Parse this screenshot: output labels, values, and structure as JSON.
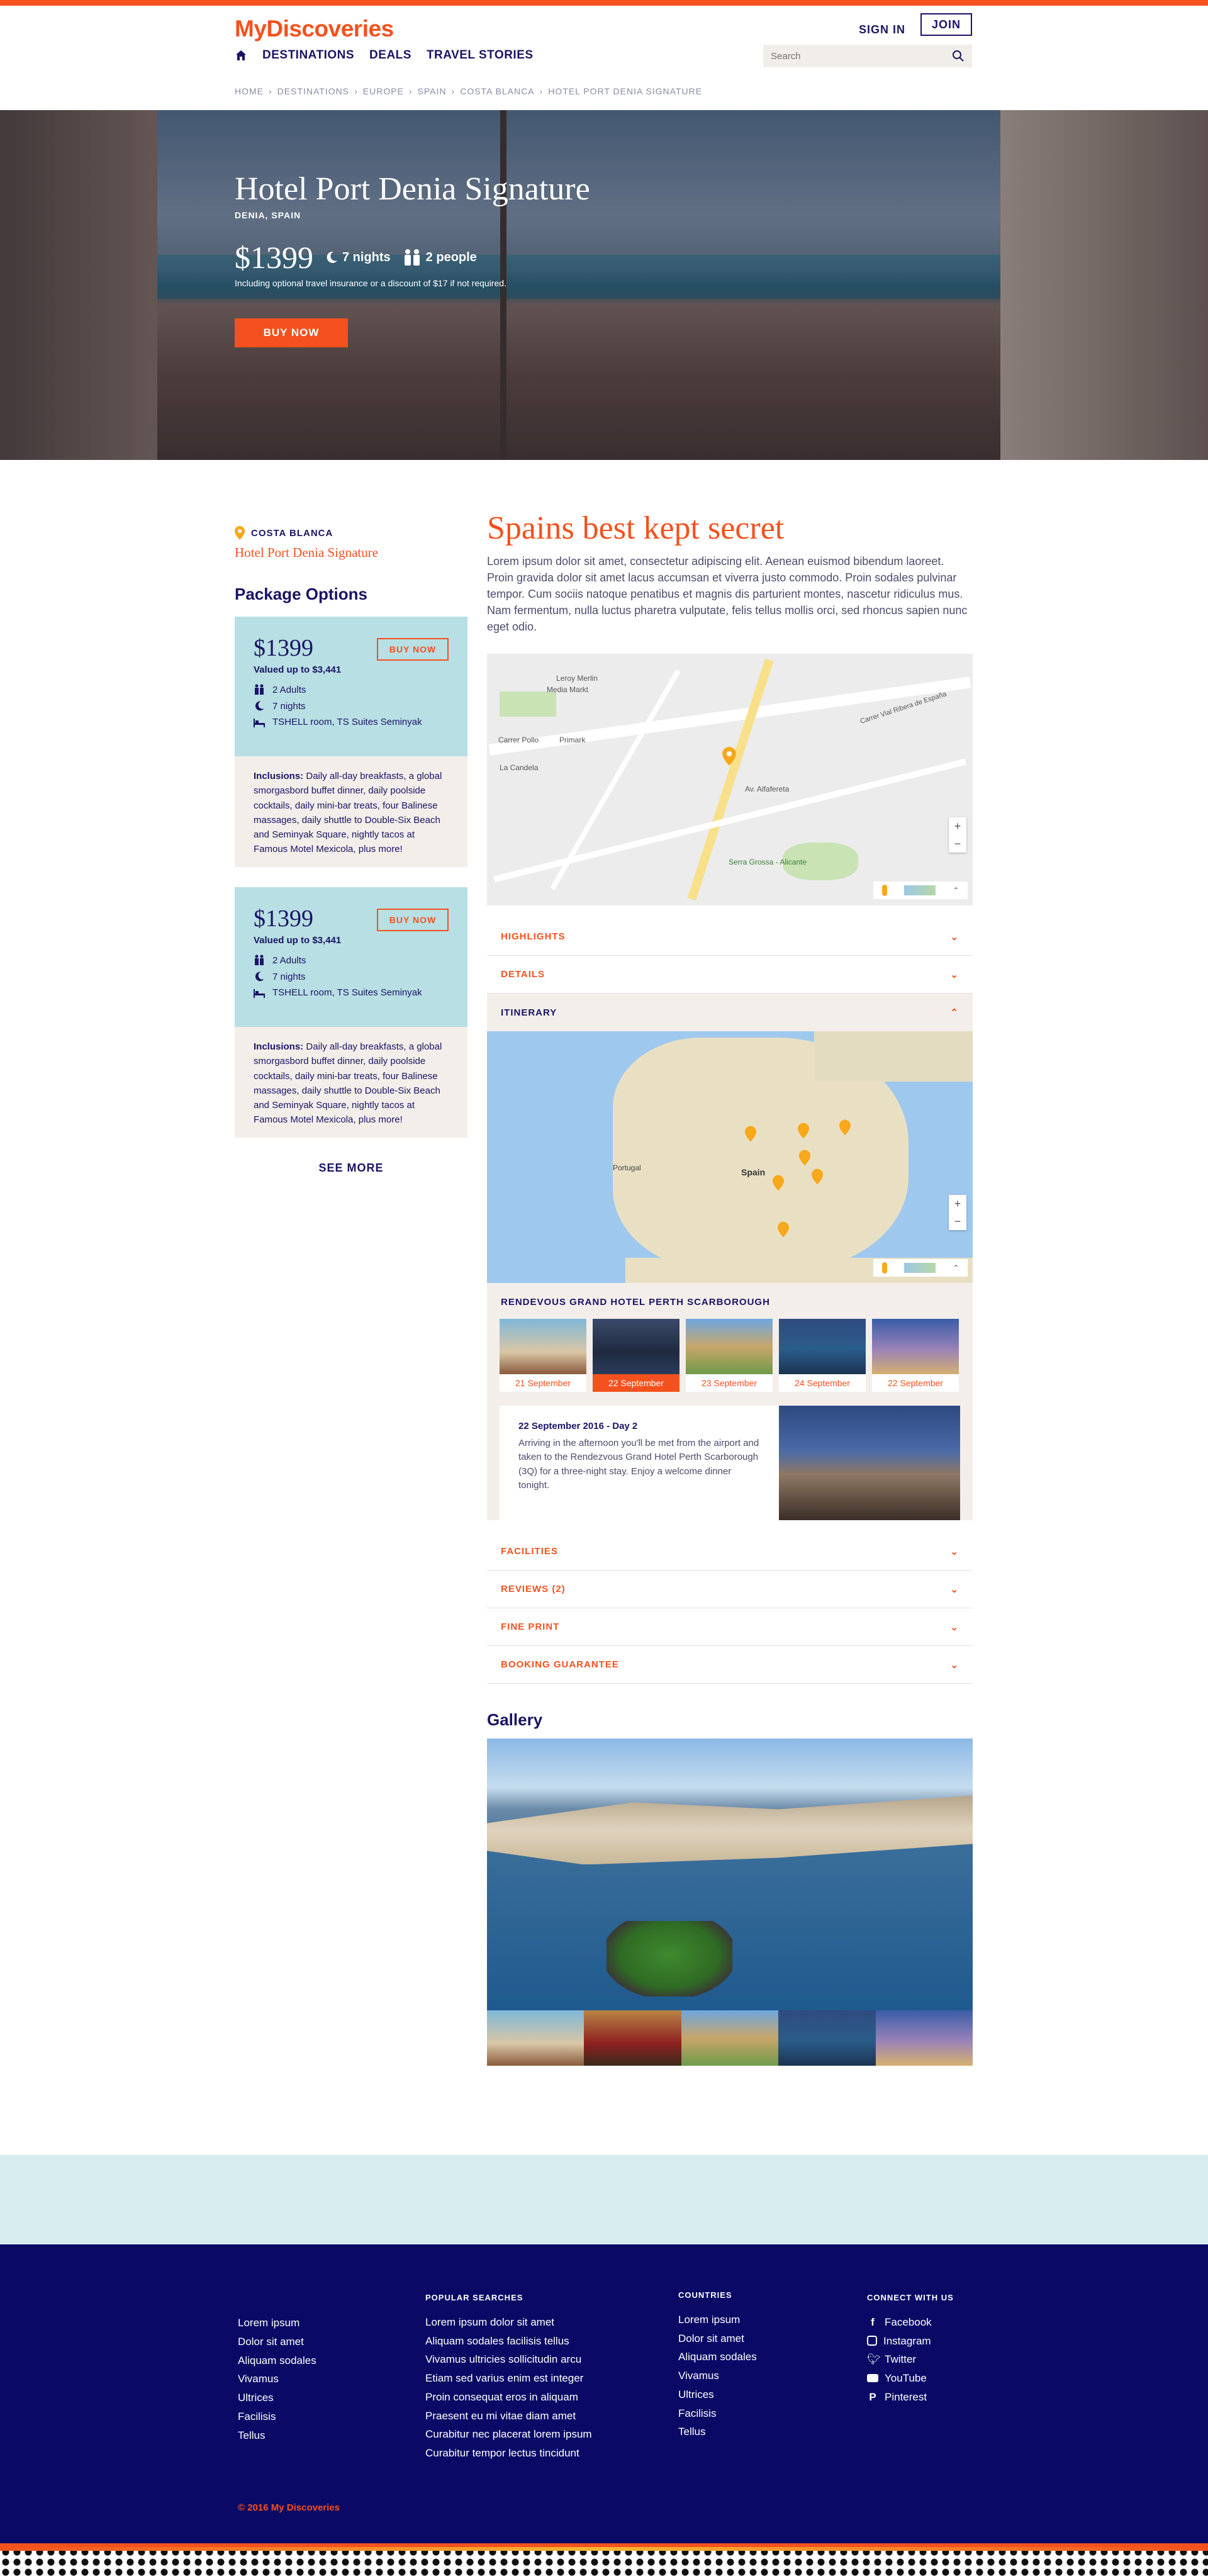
{
  "brand": {
    "logo": "MyDiscoveries",
    "accent": "#f4511e",
    "navy": "#1a1464"
  },
  "header": {
    "signin": "SIGN IN",
    "join": "JOIN",
    "nav": [
      "DESTINATIONS",
      "DEALS",
      "TRAVEL STORIES"
    ],
    "search_placeholder": "Search"
  },
  "breadcrumb": [
    "HOME",
    "DESTINATIONS",
    "EUROPE",
    "SPAIN",
    "COSTA BLANCA",
    "HOTEL PORT DENIA SIGNATURE"
  ],
  "hero": {
    "title": "Hotel Port Denia Signature",
    "subtitle": "DENIA, SPAIN",
    "price": "$1399",
    "nights": "7 nights",
    "people": "2 people",
    "note": "Including optional travel insurance or a discount of $17 if not required.",
    "buy": "BUY NOW"
  },
  "left": {
    "region": "COSTA BLANCA",
    "hotel": "Hotel Port Denia Signature",
    "heading": "Package Options",
    "packages": [
      {
        "price": "$1399",
        "valued": "Valued up to $3,441",
        "buy": "BUY NOW",
        "adults": "2 Adults",
        "nights": "7 nights",
        "room": "TSHELL room, TS Suites Seminyak",
        "inclusions_label": "Inclusions:",
        "inclusions": " Daily all-day breakfasts, a global smorgasbord buffet dinner, daily poolside cocktails, daily mini-bar treats, four Balinese massages, daily shuttle to Double-Six Beach and Seminyak Square, nightly tacos at Famous Motel Mexicola, plus more!"
      },
      {
        "price": "$1399",
        "valued": "Valued up to $3,441",
        "buy": "BUY NOW",
        "adults": "2 Adults",
        "nights": "7 nights",
        "room": "TSHELL room, TS Suites Seminyak",
        "inclusions_label": "Inclusions:",
        "inclusions": " Daily all-day breakfasts, a global smorgasbord buffet dinner, daily poolside cocktails, daily mini-bar treats, four Balinese massages, daily shuttle to Double-Six Beach and Seminyak Square, nightly tacos at Famous Motel Mexicola, plus more!"
      }
    ],
    "see_more": "SEE MORE"
  },
  "main": {
    "title": "Spains best kept secret",
    "text": "Lorem ipsum dolor sit amet, consectetur adipiscing elit. Aenean euismod bibendum laoreet. Proin gravida dolor sit amet lacus accumsan et viverra justo commodo. Proin sodales pulvinar tempor. Cum sociis natoque penatibus et magnis dis parturient montes, nascetur ridiculus mus. Nam fermentum, nulla luctus pharetra vulputate, felis tellus mollis orci, sed rhoncus sapien nunc eget odio.",
    "map_labels": [
      "Leroy Merlin",
      "Media Markt",
      "Carrer Pollo",
      "Primark",
      "La Candela",
      "Av. Alfafereta",
      "Serra Grossa - Alicante",
      "Carrer Vial Ribera de España"
    ],
    "accordion_top": [
      "HIGHLIGHTS",
      "DETAILS"
    ],
    "itinerary": "ITINERARY",
    "map2_labels": [
      "Portugal",
      "Spain"
    ],
    "itinerary_title": "RENDEVOUS GRAND HOTEL PERTH SCARBOROUGH",
    "days": [
      "21 September",
      "22 September",
      "23 September",
      "24 September",
      "22 September"
    ],
    "day_title": "22 September 2016 - Day 2",
    "day_text": "Arriving in the afternoon you'll be met from the airport and taken to the Rendezvous Grand Hotel Perth Scarborough (3Q) for a three-night stay. Enjoy a welcome dinner tonight.",
    "accordion_bottom": [
      "FACILITIES",
      "REVIEWS (2)",
      "FINE PRINT",
      "BOOKING GUARANTEE"
    ],
    "gallery": "Gallery"
  },
  "footer": {
    "col1": [
      "Lorem ipsum",
      "Dolor sit amet",
      "Aliquam sodales",
      "Vivamus",
      "Ultrices",
      "Facilisis",
      "Tellus"
    ],
    "popular_h": "POPULAR SEARCHES",
    "popular": [
      "Lorem ipsum dolor sit amet",
      "Aliquam sodales facilisis tellus",
      "Vivamus ultricies sollicitudin arcu",
      "Etiam sed varius enim est integer",
      "Proin consequat eros in aliquam",
      "Praesent eu mi vitae diam amet",
      "Curabitur nec placerat lorem ipsum",
      "Curabitur tempor lectus tincidunt"
    ],
    "countries_h": "COUNTRIES",
    "countries": [
      "Lorem ipsum",
      "Dolor sit amet",
      "Aliquam sodales",
      "Vivamus",
      "Ultrices",
      "Facilisis",
      "Tellus"
    ],
    "connect_h": "CONNECT WITH US",
    "social": [
      "Facebook",
      "Instagram",
      "Twitter",
      "YouTube",
      "Pinterest"
    ],
    "copyright": "© 2016 My Discoveries"
  }
}
